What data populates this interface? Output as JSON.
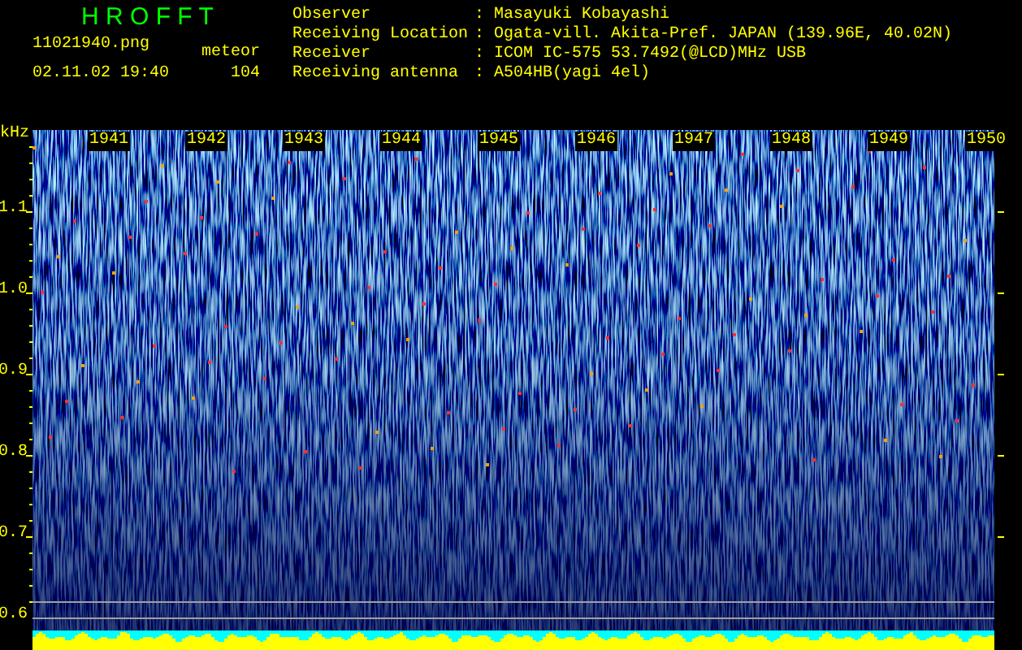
{
  "app_title": "H R O F F T",
  "file_name": "11021940.png",
  "date_time": "02.11.02 19:40",
  "meteor_label": "meteor",
  "meteor_count": "104",
  "info": [
    {
      "label": "Observer",
      "separator": ":",
      "value": "Masayuki Kobayashi"
    },
    {
      "label": "Receiving Location",
      "separator": ":",
      "value": "Ogata-vill. Akita-Pref. JAPAN (139.96E, 40.02N)"
    },
    {
      "label": "Receiver",
      "separator": ":",
      "value": "ICOM IC-575 53.7492(@LCD)MHz USB"
    },
    {
      "label": "Receiving antenna",
      "separator": ":",
      "value": "A504HB(yagi 4el)"
    }
  ],
  "spectrogram": {
    "y_unit": "kHz",
    "y_ticks": [
      "1.1",
      "1.0",
      "0.9",
      "0.8",
      "0.7",
      "0.6"
    ],
    "time_labels": [
      "1941",
      "1942",
      "1943",
      "1944",
      "1945",
      "1946",
      "1947",
      "1948",
      "1949",
      "1950"
    ]
  }
}
